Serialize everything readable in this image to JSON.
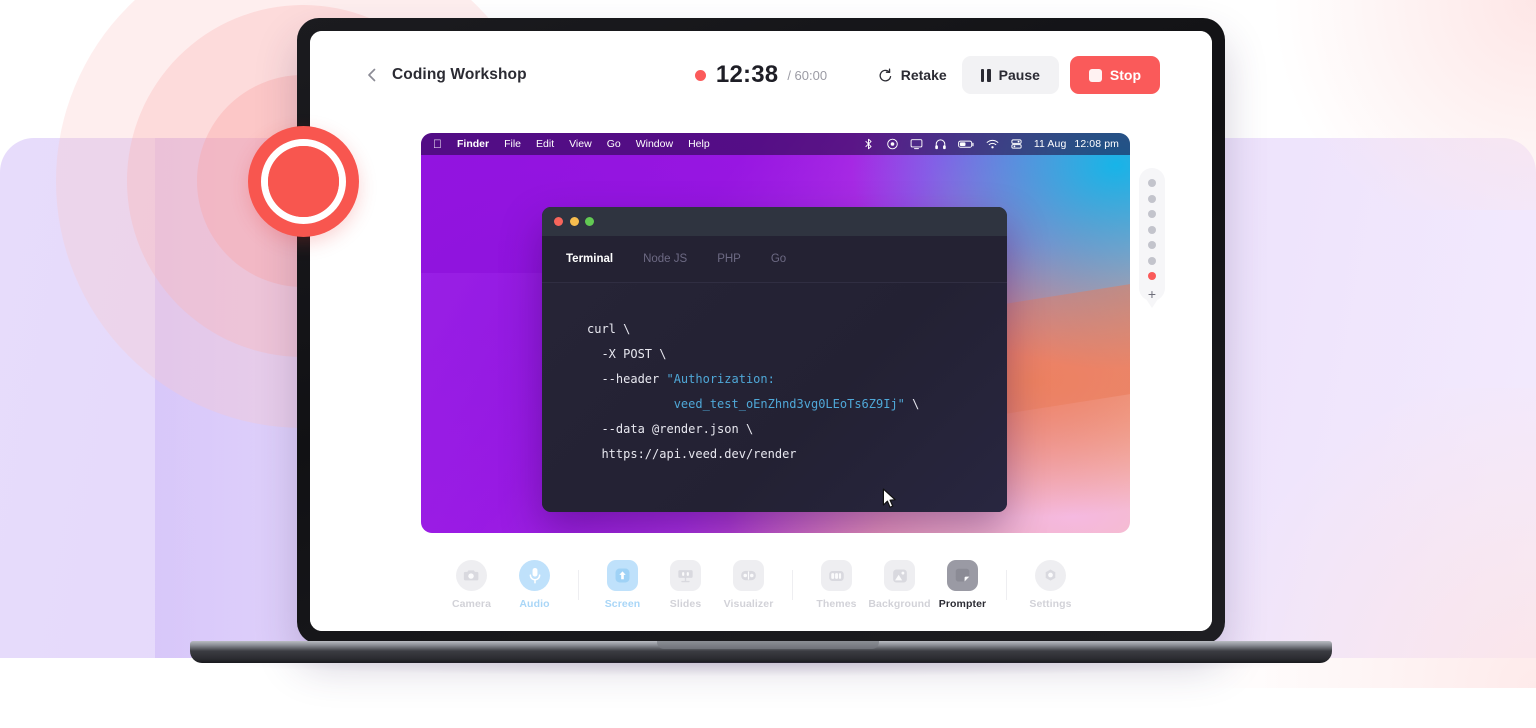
{
  "app": {
    "header": {
      "back_icon": "chevron-left-icon",
      "project_title": "Coding Workshop",
      "record_dot_icon": "record-dot-icon",
      "timer_current": "12:38",
      "timer_total": "/ 60:00",
      "retake_label": "Retake",
      "retake_icon": "rotate-ccw-icon",
      "pause_label": "Pause",
      "pause_icon": "pause-icon",
      "stop_label": "Stop",
      "stop_icon": "stop-square-icon"
    },
    "record_overlay": {
      "icon": "record-button-icon"
    },
    "slide_panel": {
      "dots": [
        {
          "state": "inactive"
        },
        {
          "state": "inactive"
        },
        {
          "state": "inactive"
        },
        {
          "state": "inactive"
        },
        {
          "state": "inactive"
        },
        {
          "state": "inactive"
        },
        {
          "state": "active"
        }
      ],
      "add_label": "+",
      "active_color": "#fa5a5a",
      "inactive_color": "#c3c4cc"
    },
    "toolbar": {
      "items": [
        {
          "label": "Camera",
          "icon": "camera-icon",
          "state": "muted",
          "shape": "circle"
        },
        {
          "label": "Audio",
          "icon": "microphone-icon",
          "state": "active-blue",
          "shape": "circle"
        },
        {
          "label": "Screen",
          "icon": "screen-share-icon",
          "state": "active-blue",
          "shape": "square"
        },
        {
          "label": "Slides",
          "icon": "slides-icon",
          "state": "muted",
          "shape": "square"
        },
        {
          "label": "Visualizer",
          "icon": "visualizer-icon",
          "state": "muted",
          "shape": "square"
        },
        {
          "label": "Themes",
          "icon": "themes-icon",
          "state": "muted",
          "shape": "square"
        },
        {
          "label": "Background",
          "icon": "image-icon",
          "state": "muted",
          "shape": "square"
        },
        {
          "label": "Prompter",
          "icon": "prompter-icon",
          "state": "active-dark",
          "shape": "square"
        },
        {
          "label": "Settings",
          "icon": "gear-icon",
          "state": "muted",
          "shape": "circle"
        }
      ]
    }
  },
  "desktop": {
    "menubar": {
      "apple_icon": "apple-logo-icon",
      "menus": [
        "Finder",
        "File",
        "Edit",
        "View",
        "Go",
        "Window",
        "Help"
      ],
      "status_icons": [
        "bluetooth-icon",
        "screen-record-icon",
        "display-icon",
        "headphones-icon",
        "battery-icon",
        "wifi-icon",
        "control-center-icon"
      ],
      "date": "11 Aug",
      "time": "12:08 pm"
    },
    "cursor_icon": "mouse-pointer-icon"
  },
  "terminal": {
    "traffic_lights": [
      "close-button",
      "minimize-button",
      "maximize-button"
    ],
    "tabs": [
      {
        "label": "Terminal",
        "active": true
      },
      {
        "label": "Node JS",
        "active": false
      },
      {
        "label": "PHP",
        "active": false
      },
      {
        "label": "Go",
        "active": false
      }
    ],
    "code": {
      "line1": "curl \\",
      "line2": "  -X POST \\",
      "line3_pre": "  --header ",
      "line3_str": "\"Authorization:",
      "line4_str": "veed_test_oEnZhnd3vg0LEoTs6Z9Ij\"",
      "line4_post": " \\",
      "line5": "  --data @render.json \\",
      "line6": "  https://api.veed.dev/render"
    }
  },
  "colors": {
    "accent_red": "#fa5a5a",
    "accent_blue": "#bfe1fb",
    "lavender_bg": "#e5d9fb",
    "terminal_bg": "#262436",
    "code_string": "#4fa8d8"
  }
}
